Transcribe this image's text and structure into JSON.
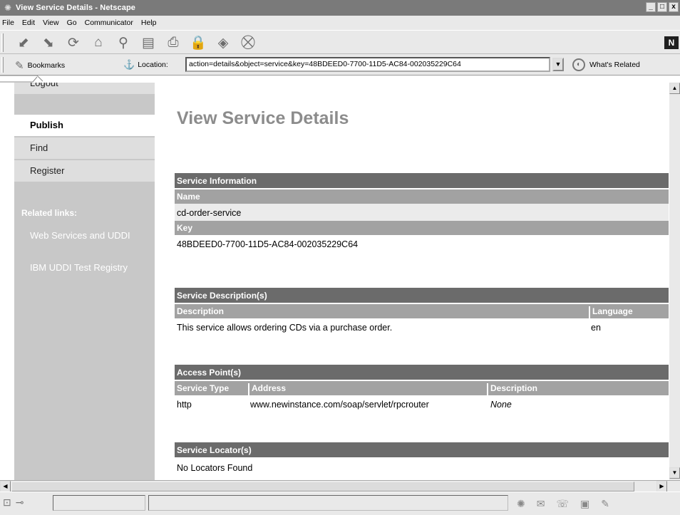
{
  "window": {
    "title": "View Service Details - Netscape",
    "controls": [
      "_",
      "□",
      "x"
    ]
  },
  "menu": [
    "File",
    "Edit",
    "View",
    "Go",
    "Communicator",
    "Help"
  ],
  "toolbar": {
    "buttons": [
      "back-icon",
      "forward-icon",
      "reload-icon",
      "home-icon",
      "search-icon",
      "guide-icon",
      "print-icon",
      "security-icon",
      "shop-icon",
      "stop-icon"
    ],
    "brand_letter": "N"
  },
  "locationbar": {
    "bookmarks_label": "Bookmarks",
    "location_label": "Location:",
    "url": "action=details&object=service&key=48BDEED0-7700-11D5-AC84-002035229C64",
    "whats_related_label": "What's Related"
  },
  "sidebar": {
    "nav": [
      "Logout",
      "Publish",
      "Find",
      "Register"
    ],
    "active": "Publish",
    "related_title": "Related links:",
    "links": [
      "Web Services and UDDI",
      "IBM UDDI Test Registry"
    ]
  },
  "page": {
    "title": "View Service Details",
    "service_info": {
      "heading": "Service Information",
      "name_label": "Name",
      "name_value": "cd-order-service",
      "key_label": "Key",
      "key_value": "48BDEED0-7700-11D5-AC84-002035229C64"
    },
    "descriptions": {
      "heading": "Service Description(s)",
      "columns": [
        "Description",
        "Language"
      ],
      "rows": [
        [
          "This service allows ordering CDs via a purchase order.",
          "en"
        ]
      ]
    },
    "access_points": {
      "heading": "Access Point(s)",
      "columns": [
        "Service Type",
        "Address",
        "Description"
      ],
      "rows": [
        [
          "http",
          "www.newinstance.com/soap/servlet/rpcrouter",
          "None"
        ]
      ]
    },
    "locators": {
      "heading": "Service Locator(s)",
      "message": "No Locators Found"
    }
  }
}
